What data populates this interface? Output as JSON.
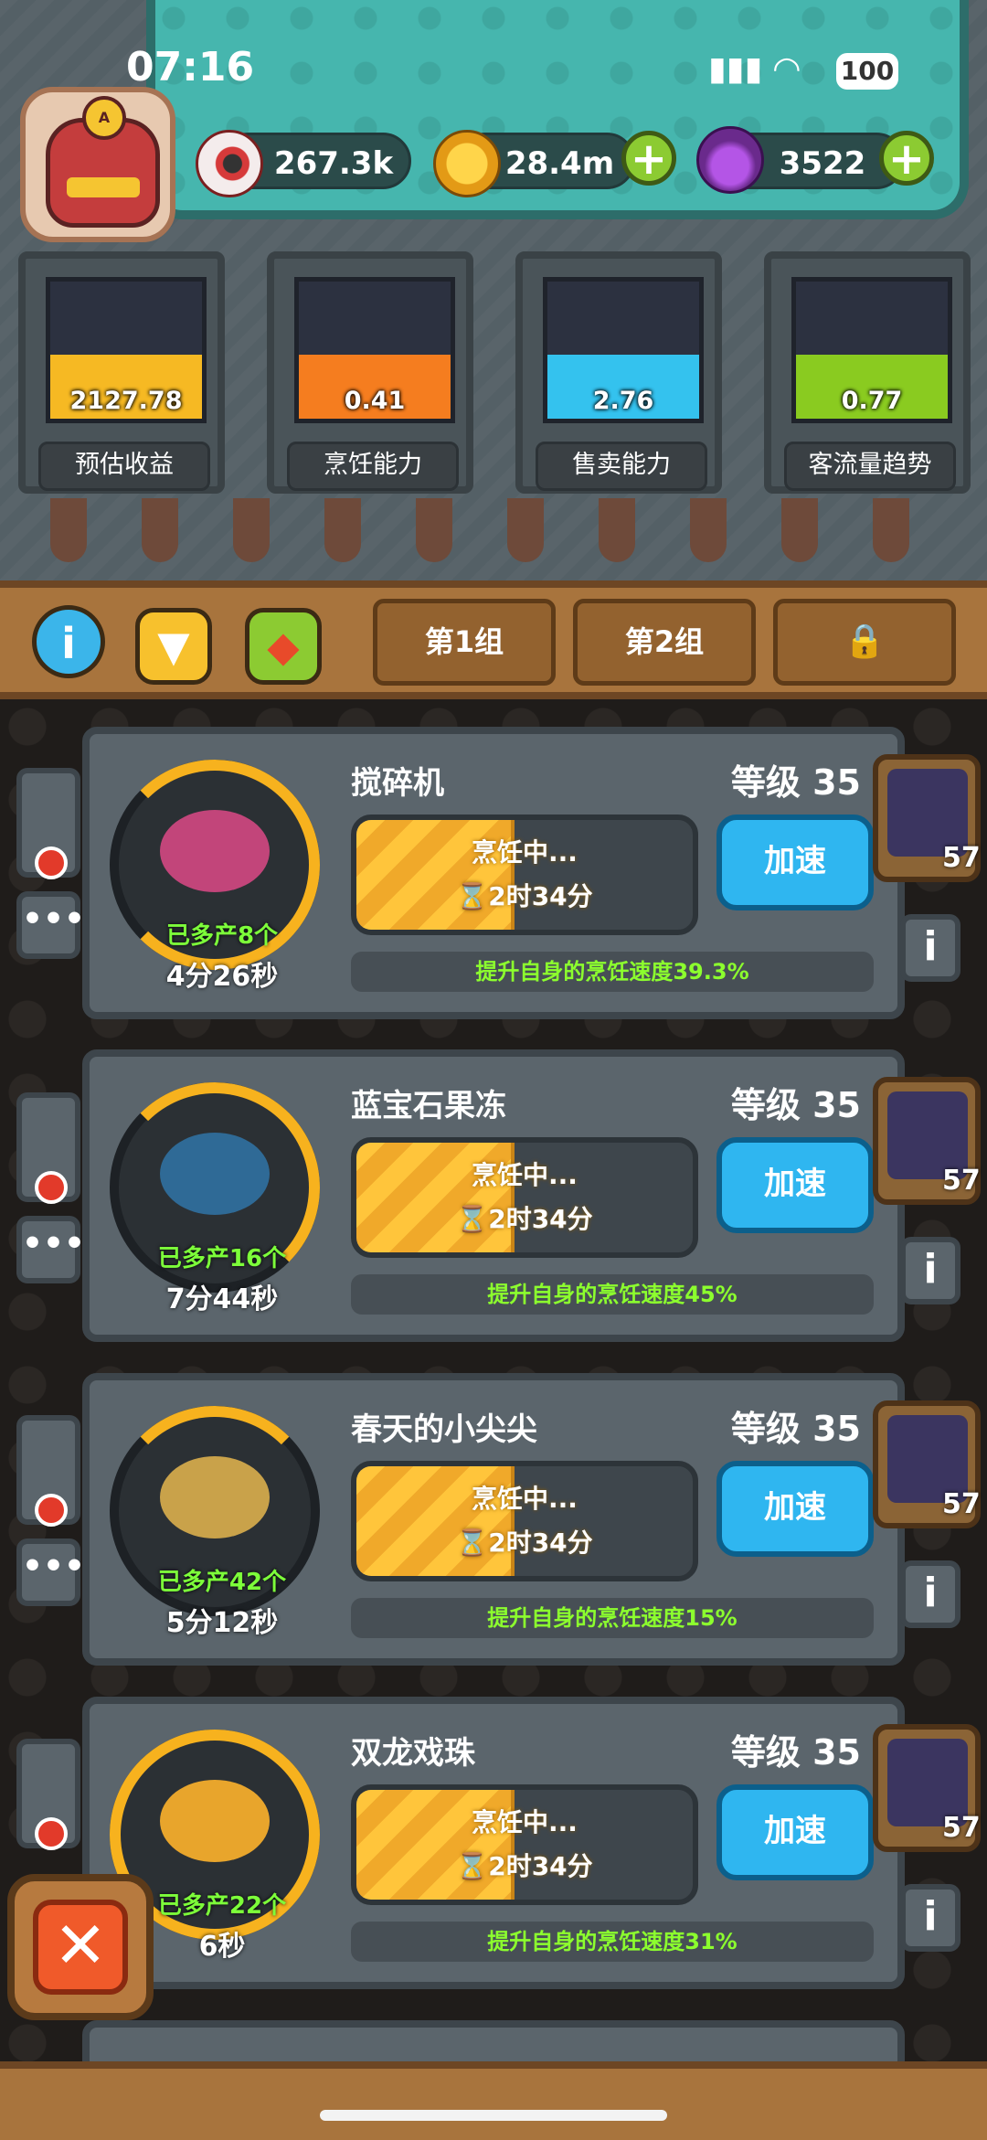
{
  "status_bar": {
    "time": "07:16",
    "battery": "100"
  },
  "resources": {
    "eyes": {
      "value": "267.3k",
      "icon": "eyeball-icon"
    },
    "coins": {
      "value": "28.4m",
      "icon": "coin-icon"
    },
    "potion": {
      "value": "3522",
      "icon": "potion-icon"
    }
  },
  "stats": [
    {
      "value": "2127.78",
      "label": "预估收益",
      "color": "#f6b923"
    },
    {
      "value": "0.41",
      "label": "烹饪能力",
      "color": "#f57d1f"
    },
    {
      "value": "2.76",
      "label": "售卖能力",
      "color": "#34c2ee"
    },
    {
      "value": "0.77",
      "label": "客流量趋势",
      "color": "#8acb20"
    }
  ],
  "toolbar": {
    "groups": [
      "第1组",
      "第2组"
    ],
    "locked_tab_icon": "lock-icon"
  },
  "cards": [
    {
      "name": "搅碎机",
      "level": "等级 35",
      "extra": "已多产8个",
      "timer": "4分26秒",
      "status": "烹饪中...",
      "remaining": "⌛2时34分",
      "button": "加速",
      "bonus": "提升自身的烹饪速度39.3%",
      "pkg_count": "57",
      "food_color": "#c2457a"
    },
    {
      "name": "蓝宝石果冻",
      "level": "等级 35",
      "extra": "已多产16个",
      "timer": "7分44秒",
      "status": "烹饪中...",
      "remaining": "⌛2时34分",
      "button": "加速",
      "bonus": "提升自身的烹饪速度45%",
      "pkg_count": "57",
      "food_color": "#2f6a96"
    },
    {
      "name": "春天的小尖尖",
      "level": "等级 35",
      "extra": "已多产42个",
      "timer": "5分12秒",
      "status": "烹饪中...",
      "remaining": "⌛2时34分",
      "button": "加速",
      "bonus": "提升自身的烹饪速度15%",
      "pkg_count": "57",
      "food_color": "#c9a24a"
    },
    {
      "name": "双龙戏珠",
      "level": "等级 35",
      "extra": "已多产22个",
      "timer": "6秒",
      "status": "烹饪中...",
      "remaining": "⌛2时34分",
      "button": "加速",
      "bonus": "提升自身的烹饪速度31%",
      "pkg_count": "57",
      "food_color": "#e8a52c"
    }
  ]
}
